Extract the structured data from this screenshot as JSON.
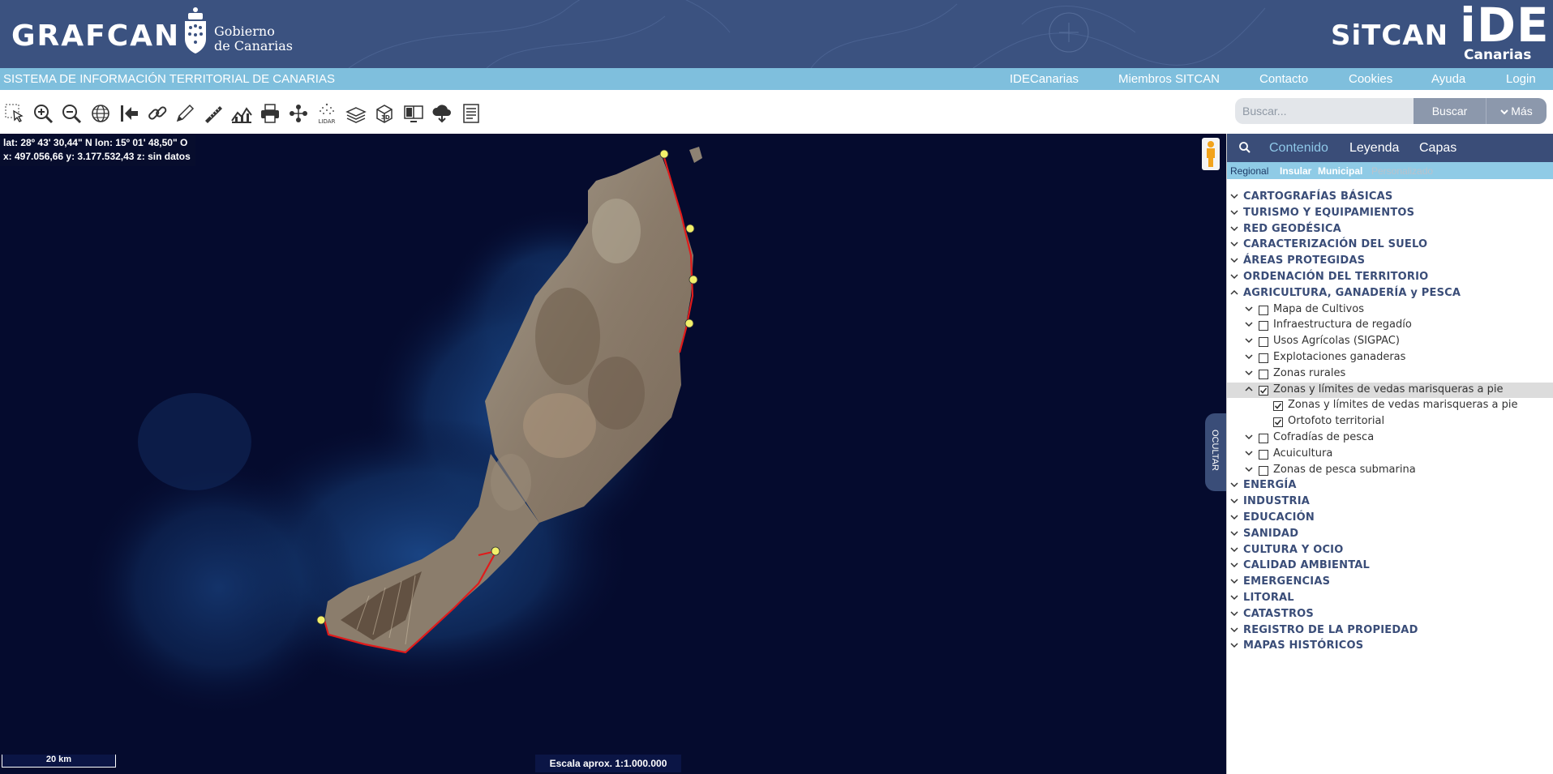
{
  "header": {
    "brand": "GRAFCAN",
    "gobierno_line1": "Gobierno",
    "gobierno_line2": "de Canarias",
    "sitcan": "SiTCAN",
    "ide": "iDE",
    "ide_sub": "Canarias"
  },
  "navbar": {
    "title": "SISTEMA DE INFORMACIÓN TERRITORIAL DE CANARIAS",
    "links": [
      "IDECanarias",
      "Miembros SITCAN",
      "Contacto",
      "Cookies",
      "Ayuda",
      "Login"
    ]
  },
  "toolbar": {
    "tools": [
      "select-icon",
      "zoom-in-icon",
      "zoom-out-icon",
      "globe-icon",
      "back-icon",
      "link-icon",
      "pencil-icon",
      "measure-icon",
      "profile-icon",
      "print-icon",
      "network-icon",
      "lidar-icon",
      "layers-icon",
      "3d-icon",
      "compare-icon",
      "cloud-download-icon",
      "report-icon"
    ],
    "lidar_label": "LIDAR",
    "search_placeholder": "Buscar...",
    "search_button": "Buscar",
    "more_button": "Más"
  },
  "map": {
    "coord_line1": "lat: 28º 43' 30,44\" N  lon: 15º 01' 48,50\" O",
    "coord_line2": "x: 497.056,66  y: 3.177.532,43  z: sin datos",
    "scale_bar": "20 km",
    "scale_text": "Escala aprox. 1:1.000.000",
    "hide_button": "OCULTAR"
  },
  "panel": {
    "tabs": [
      "Contenido",
      "Leyenda",
      "Capas"
    ],
    "subtabs": [
      "Regional",
      "Insular",
      "Municipal",
      "Personalizado"
    ],
    "tree": [
      {
        "label": "CARTOGRAFÍAS BÁSICAS",
        "level": 0,
        "expanded": false
      },
      {
        "label": "TURISMO Y EQUIPAMIENTOS",
        "level": 0,
        "expanded": false
      },
      {
        "label": "RED GEODÉSICA",
        "level": 0,
        "expanded": false
      },
      {
        "label": "CARACTERIZACIÓN DEL SUELO",
        "level": 0,
        "expanded": false
      },
      {
        "label": "ÁREAS PROTEGIDAS",
        "level": 0,
        "expanded": false
      },
      {
        "label": "ORDENACIÓN DEL TERRITORIO",
        "level": 0,
        "expanded": false
      },
      {
        "label": "AGRICULTURA, GANADERÍA y PESCA",
        "level": 0,
        "expanded": true
      },
      {
        "label": "Mapa de Cultivos",
        "level": 1,
        "expanded": false,
        "checked": false
      },
      {
        "label": "Infraestructura de regadío",
        "level": 1,
        "expanded": false,
        "checked": false
      },
      {
        "label": "Usos Agrícolas (SIGPAC)",
        "level": 1,
        "expanded": false,
        "checked": false
      },
      {
        "label": "Explotaciones ganaderas",
        "level": 1,
        "expanded": false,
        "checked": false
      },
      {
        "label": "Zonas rurales",
        "level": 1,
        "expanded": false,
        "checked": false
      },
      {
        "label": "Zonas y límites de vedas marisqueras a pie",
        "level": 1,
        "expanded": true,
        "checked": true,
        "highlight": true
      },
      {
        "label": "Zonas y límites de vedas marisqueras a pie",
        "level": 2,
        "checked": true
      },
      {
        "label": "Ortofoto territorial",
        "level": 2,
        "checked": true
      },
      {
        "label": "Cofradías de pesca",
        "level": 1,
        "expanded": false,
        "checked": false
      },
      {
        "label": "Acuicultura",
        "level": 1,
        "expanded": false,
        "checked": false
      },
      {
        "label": "Zonas de pesca submarina",
        "level": 1,
        "expanded": false,
        "checked": false
      },
      {
        "label": "ENERGÍA",
        "level": 0,
        "expanded": false
      },
      {
        "label": "INDUSTRIA",
        "level": 0,
        "expanded": false
      },
      {
        "label": "EDUCACIÓN",
        "level": 0,
        "expanded": false
      },
      {
        "label": "SANIDAD",
        "level": 0,
        "expanded": false
      },
      {
        "label": "CULTURA Y OCIO",
        "level": 0,
        "expanded": false
      },
      {
        "label": "CALIDAD AMBIENTAL",
        "level": 0,
        "expanded": false
      },
      {
        "label": "EMERGENCIAS",
        "level": 0,
        "expanded": false
      },
      {
        "label": "LITORAL",
        "level": 0,
        "expanded": false
      },
      {
        "label": "CATASTROS",
        "level": 0,
        "expanded": false
      },
      {
        "label": "REGISTRO DE LA PROPIEDAD",
        "level": 0,
        "expanded": false
      },
      {
        "label": "MAPAS HISTÓRICOS",
        "level": 0,
        "expanded": false
      }
    ]
  },
  "colors": {
    "header": "#3b5280",
    "navbar": "#7fbfdd",
    "panel_tabs": "#3a4d78",
    "ocean": "#050b2e",
    "coast_line": "#e01b1b",
    "marker": "#f2f06a"
  }
}
